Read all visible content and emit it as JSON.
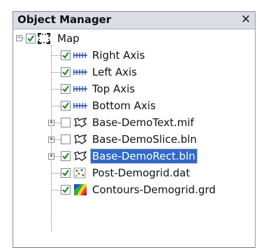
{
  "window": {
    "title": "Object Manager",
    "close_glyph": "✕"
  },
  "tree": {
    "root": {
      "label": "Map",
      "expanded": true,
      "checked": true
    },
    "items": [
      {
        "label": "Right Axis",
        "icon": "axis-icon",
        "checked": true,
        "selected": false,
        "expandable": false
      },
      {
        "label": "Left Axis",
        "icon": "axis-icon",
        "checked": true,
        "selected": false,
        "expandable": false
      },
      {
        "label": "Top Axis",
        "icon": "axis-icon",
        "checked": true,
        "selected": false,
        "expandable": false
      },
      {
        "label": "Bottom Axis",
        "icon": "axis-icon",
        "checked": true,
        "selected": false,
        "expandable": false
      },
      {
        "label": "Base-DemoText.mif",
        "icon": "base-map-icon",
        "checked": false,
        "selected": false,
        "expandable": true
      },
      {
        "label": "Base-DemoSlice.bln",
        "icon": "base-map-icon",
        "checked": false,
        "selected": false,
        "expandable": true
      },
      {
        "label": "Base-DemoRect.bln",
        "icon": "base-map-icon",
        "checked": true,
        "selected": true,
        "expandable": true
      },
      {
        "label": "Post-Demogrid.dat",
        "icon": "post-map-icon",
        "checked": true,
        "selected": false,
        "expandable": false
      },
      {
        "label": "Contours-Demogrid.grd",
        "icon": "contour-map-icon",
        "checked": true,
        "selected": false,
        "expandable": false
      }
    ]
  },
  "colors": {
    "title_bg": "#d9dee6",
    "selection": "#3169c6",
    "check": "#1f8f1f",
    "axis": "#1e3fb0"
  }
}
